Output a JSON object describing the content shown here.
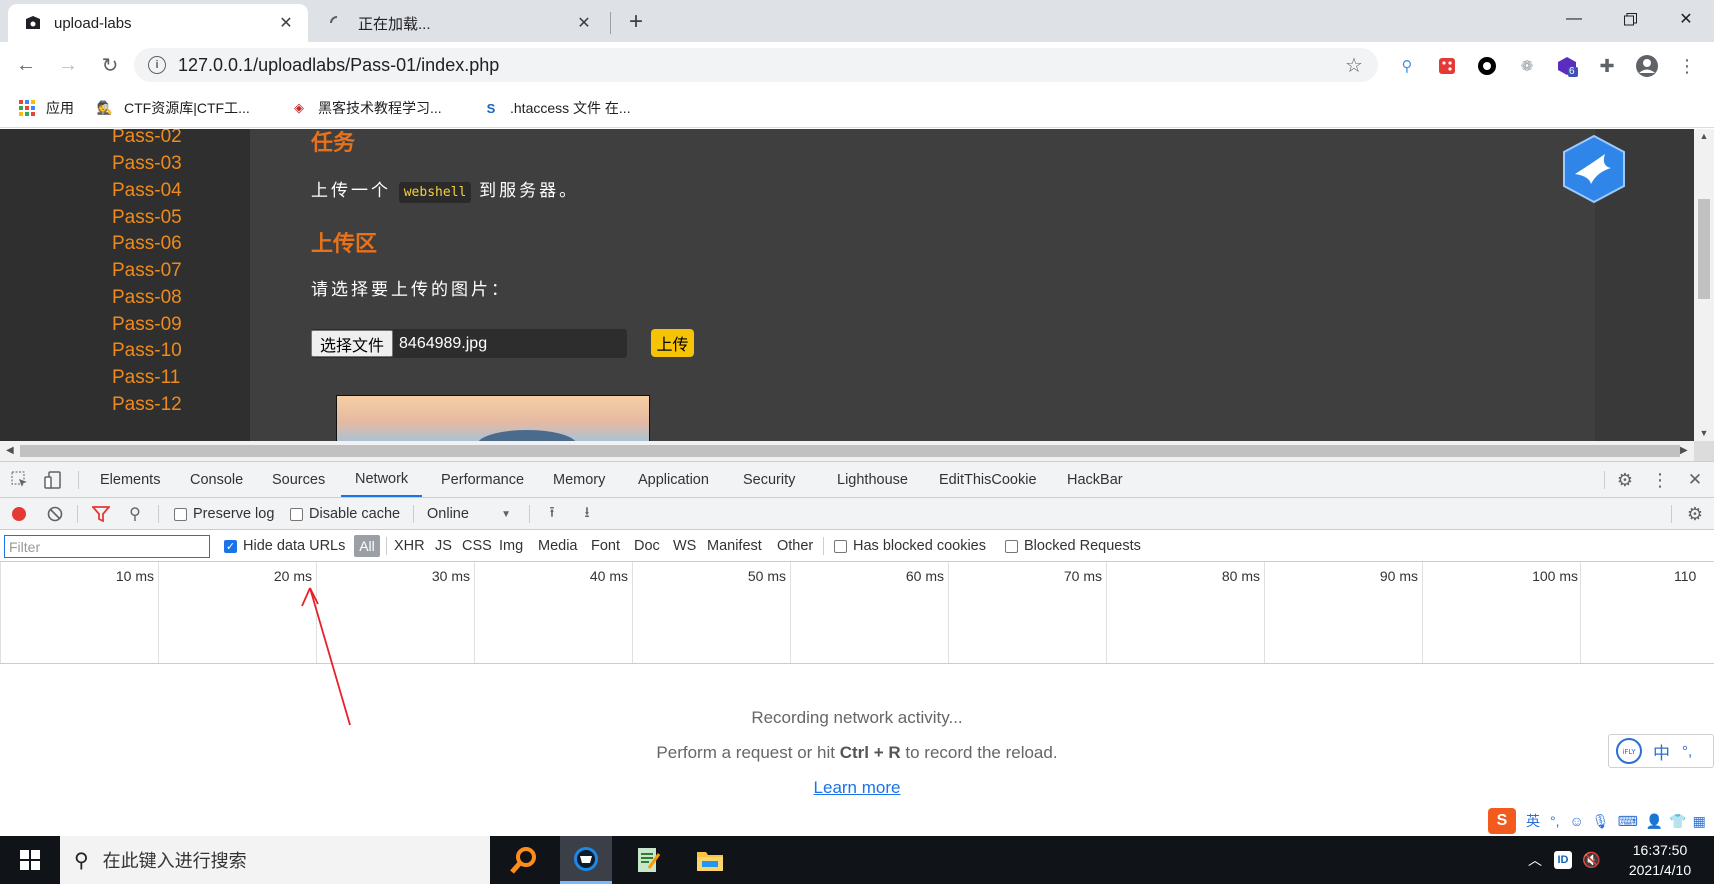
{
  "tabs": [
    {
      "title": "upload-labs",
      "active": true,
      "icon": "page-favicon-icon"
    },
    {
      "title": "正在加载...",
      "active": false,
      "icon": "loading-spinner-icon"
    }
  ],
  "address": {
    "url": "127.0.0.1/uploadlabs/Pass-01/index.php"
  },
  "extensions": {
    "count_badge": "6"
  },
  "bookmarks": [
    {
      "label": "应用",
      "icon": "apps-grid-icon"
    },
    {
      "label": "CTF资源库|CTF工...",
      "icon": "ctf-favicon-icon"
    },
    {
      "label": "黑客技术教程学习...",
      "icon": "hacker-favicon-icon"
    },
    {
      "label": ".htaccess 文件 在...",
      "icon": "s-favicon-icon"
    }
  ],
  "page": {
    "sidebar_items": [
      "Pass-02",
      "Pass-03",
      "Pass-04",
      "Pass-05",
      "Pass-06",
      "Pass-07",
      "Pass-08",
      "Pass-09",
      "Pass-10",
      "Pass-11",
      "Pass-12"
    ],
    "task_heading": "任务",
    "task_prefix": "上传一个",
    "task_code": "webshell",
    "task_suffix": "到服务器。",
    "upload_heading": "上传区",
    "select_prompt": "请选择要上传的图片：",
    "choose_file_label": "选择文件",
    "file_name": "8464989.jpg",
    "upload_button": "上传"
  },
  "devtools": {
    "tabs": [
      "Elements",
      "Console",
      "Sources",
      "Network",
      "Performance",
      "Memory",
      "Application",
      "Security",
      "Lighthouse",
      "EditThisCookie",
      "HackBar"
    ],
    "active_tab": "Network",
    "preserve_log": "Preserve log",
    "disable_cache": "Disable cache",
    "throttling": "Online",
    "filter_placeholder": "Filter",
    "hide_data_urls": "Hide data URLs",
    "hide_data_urls_checked": true,
    "filter_types": [
      "All",
      "XHR",
      "JS",
      "CSS",
      "Img",
      "Media",
      "Font",
      "Doc",
      "WS",
      "Manifest",
      "Other"
    ],
    "has_blocked_cookies": "Has blocked cookies",
    "blocked_requests": "Blocked Requests",
    "timeline_ticks": [
      "10 ms",
      "20 ms",
      "30 ms",
      "40 ms",
      "50 ms",
      "60 ms",
      "70 ms",
      "80 ms",
      "90 ms",
      "100 ms",
      "110"
    ],
    "recording_title": "Recording network activity...",
    "recording_hint_prefix": "Perform a request or hit",
    "recording_hint_key": "Ctrl + R",
    "recording_hint_suffix": "to record the reload.",
    "learn_more": "Learn more"
  },
  "ime": {
    "bar_text": "中",
    "sogou_label": "英"
  },
  "taskbar": {
    "search_placeholder": "在此键入进行搜索",
    "time": "16:37:50",
    "date": "2021/4/10"
  },
  "colors": {
    "accent": "#1a73e8",
    "pass_link": "#ef8b1c",
    "heading": "#e8711c",
    "upload_button": "#f6c307",
    "annotation_arrow": "#e8202a"
  }
}
